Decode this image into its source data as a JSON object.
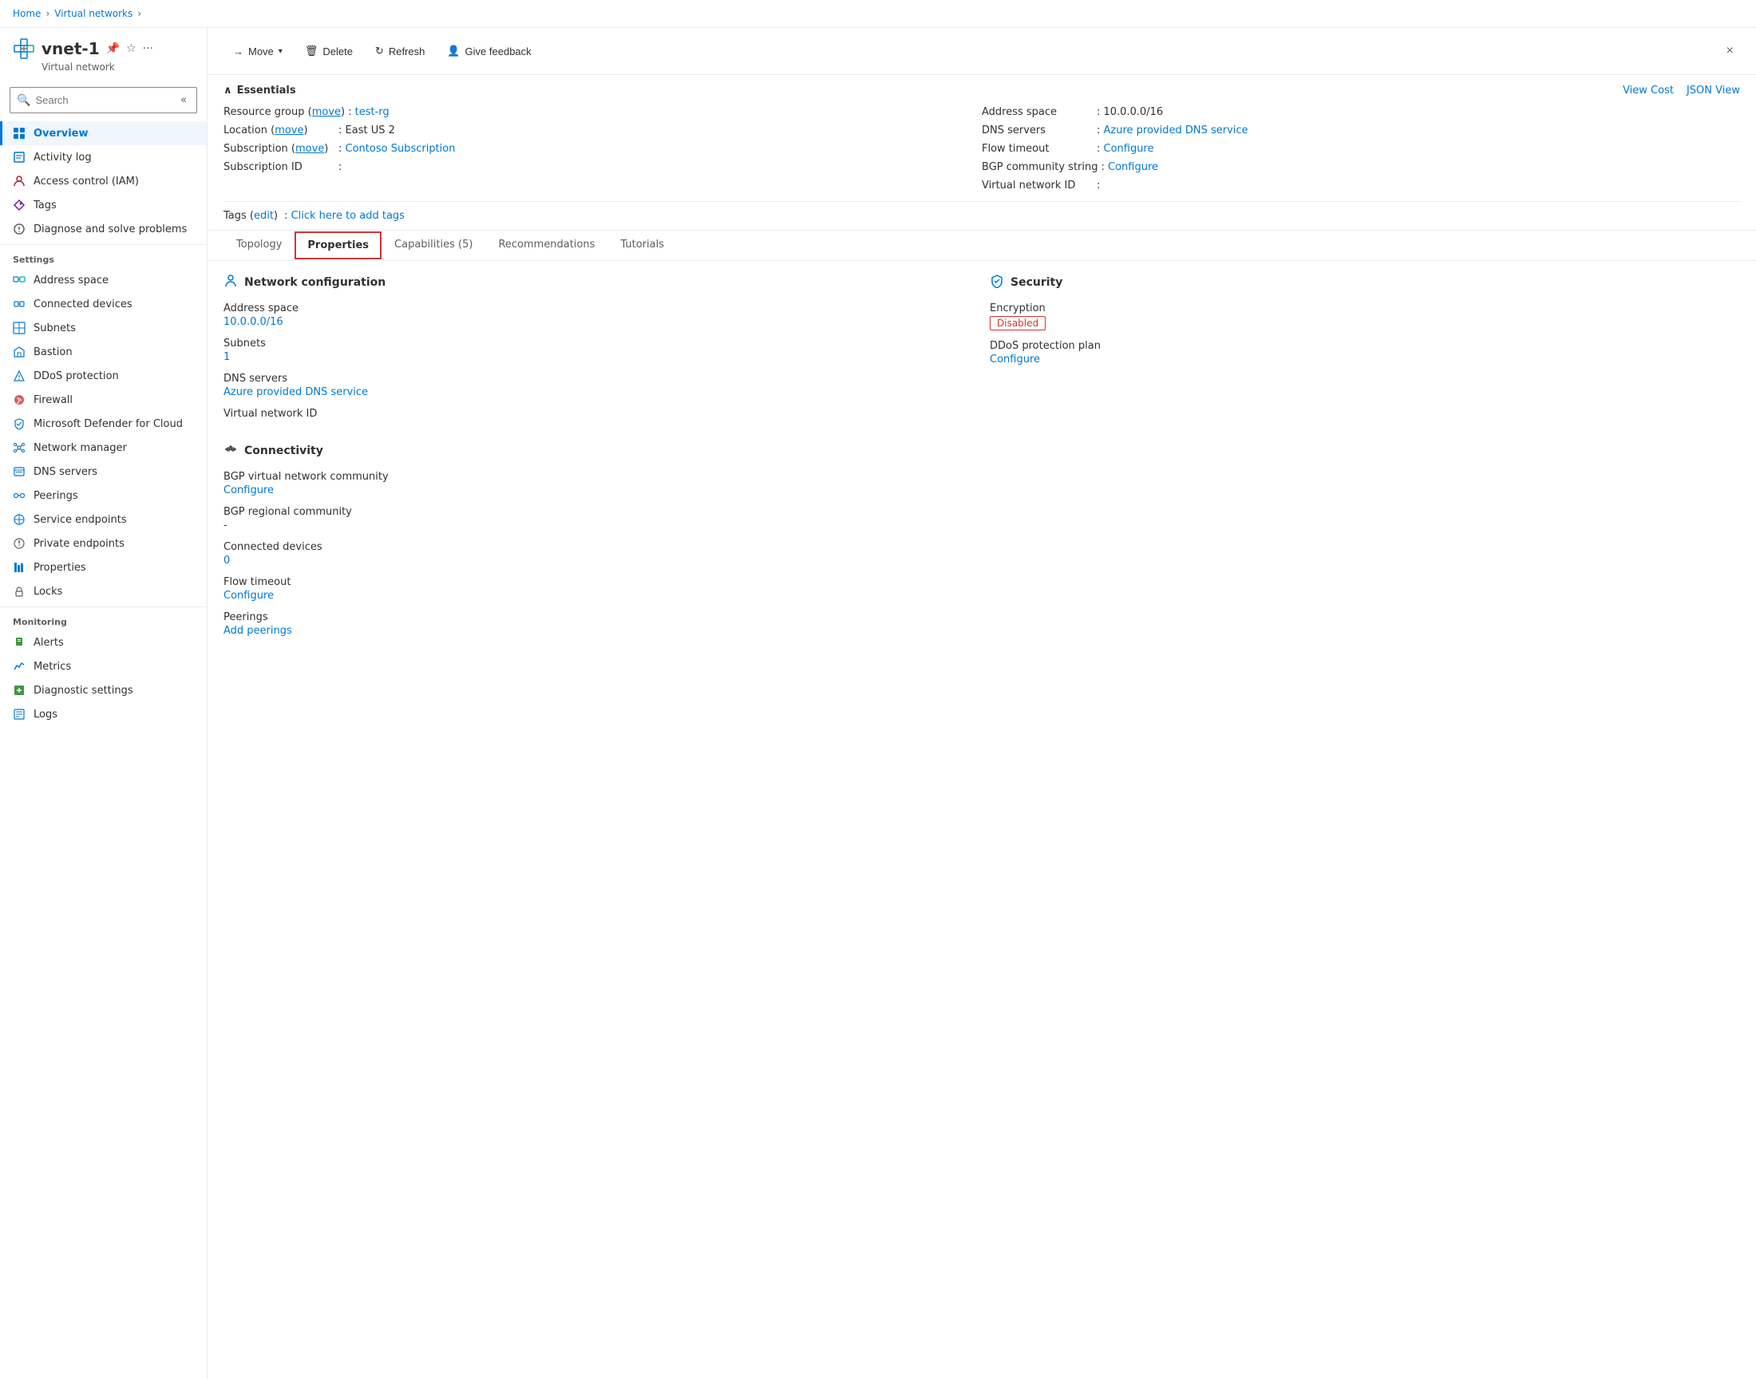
{
  "breadcrumb": {
    "items": [
      {
        "label": "Home",
        "link": true
      },
      {
        "label": "Virtual networks",
        "link": true
      },
      {
        "label": "",
        "link": false
      }
    ]
  },
  "resource": {
    "name": "vnet-1",
    "type": "Virtual network"
  },
  "toolbar": {
    "move_label": "Move",
    "delete_label": "Delete",
    "refresh_label": "Refresh",
    "feedback_label": "Give feedback",
    "close_label": "×"
  },
  "essentials": {
    "title": "Essentials",
    "view_cost_label": "View Cost",
    "json_view_label": "JSON View",
    "left_fields": [
      {
        "label": "Resource group (move)",
        "label_plain": "Resource group",
        "move_link": true,
        "value": "test-rg",
        "value_link": true
      },
      {
        "label": "Location (move)",
        "label_plain": "Location",
        "move_link": true,
        "value": "East US 2",
        "value_link": false
      },
      {
        "label": "Subscription (move)",
        "label_plain": "Subscription",
        "move_link": true,
        "value": "Contoso Subscription",
        "value_link": true
      },
      {
        "label": "Subscription ID",
        "label_plain": "Subscription ID",
        "move_link": false,
        "value": "",
        "value_link": false
      }
    ],
    "right_fields": [
      {
        "label": "Address space",
        "value": "10.0.0.0/16",
        "value_link": false
      },
      {
        "label": "DNS servers",
        "value": "Azure provided DNS service",
        "value_link": true
      },
      {
        "label": "Flow timeout",
        "value": "Configure",
        "value_link": true
      },
      {
        "label": "BGP community string",
        "value": "Configure",
        "value_link": true
      },
      {
        "label": "Virtual network ID",
        "value": "",
        "value_link": false
      }
    ]
  },
  "tags": {
    "label": "Tags (edit)",
    "value": "Click here to add tags"
  },
  "tabs": [
    {
      "label": "Topology",
      "active": false
    },
    {
      "label": "Properties",
      "active": true
    },
    {
      "label": "Capabilities (5)",
      "active": false
    },
    {
      "label": "Recommendations",
      "active": false
    },
    {
      "label": "Tutorials",
      "active": false
    }
  ],
  "network_config": {
    "section_title": "Network configuration",
    "fields": [
      {
        "label": "Address space",
        "value": "10.0.0.0/16",
        "value_link": true
      },
      {
        "label": "Subnets",
        "value": "1",
        "value_link": true
      },
      {
        "label": "DNS servers",
        "value": null
      },
      {
        "label": "DNS servers_value",
        "value": "Azure provided DNS service",
        "value_link": true
      },
      {
        "label": "Virtual network ID",
        "value": null
      }
    ]
  },
  "security": {
    "section_title": "Security",
    "fields": [
      {
        "label": "Encryption",
        "value": "Disabled",
        "is_badge": true
      },
      {
        "label": "DDoS protection plan",
        "value": "Configure",
        "value_link": true
      }
    ]
  },
  "connectivity": {
    "section_title": "Connectivity",
    "fields": [
      {
        "label": "BGP virtual network community",
        "value": null
      },
      {
        "label": "BGP virtual network community_link",
        "value": "Configure",
        "value_link": true
      },
      {
        "label": "BGP regional community",
        "value": "-",
        "value_link": false
      },
      {
        "label": "Connected devices",
        "value": null
      },
      {
        "label": "Connected devices_num",
        "value": "0",
        "value_link": true
      },
      {
        "label": "Flow timeout",
        "value": null
      },
      {
        "label": "Flow timeout_link",
        "value": "Configure",
        "value_link": true
      },
      {
        "label": "Peerings",
        "value": null
      },
      {
        "label": "Peerings_link",
        "value": "Add peerings",
        "value_link": true
      }
    ]
  },
  "sidebar": {
    "search_placeholder": "Search",
    "items": [
      {
        "label": "Overview",
        "active": true,
        "section": null,
        "icon": "overview"
      },
      {
        "label": "Activity log",
        "active": false,
        "section": null,
        "icon": "activity"
      },
      {
        "label": "Access control (IAM)",
        "active": false,
        "section": null,
        "icon": "iam"
      },
      {
        "label": "Tags",
        "active": false,
        "section": null,
        "icon": "tags"
      },
      {
        "label": "Diagnose and solve problems",
        "active": false,
        "section": null,
        "icon": "diagnose"
      },
      {
        "label": "Settings",
        "section": "Settings",
        "is_header": true
      },
      {
        "label": "Address space",
        "active": false,
        "section": "Settings",
        "icon": "address"
      },
      {
        "label": "Connected devices",
        "active": false,
        "section": "Settings",
        "icon": "connected"
      },
      {
        "label": "Subnets",
        "active": false,
        "section": "Settings",
        "icon": "subnets"
      },
      {
        "label": "Bastion",
        "active": false,
        "section": "Settings",
        "icon": "bastion"
      },
      {
        "label": "DDoS protection",
        "active": false,
        "section": "Settings",
        "icon": "ddos"
      },
      {
        "label": "Firewall",
        "active": false,
        "section": "Settings",
        "icon": "firewall"
      },
      {
        "label": "Microsoft Defender for Cloud",
        "active": false,
        "section": "Settings",
        "icon": "defender"
      },
      {
        "label": "Network manager",
        "active": false,
        "section": "Settings",
        "icon": "netmgr"
      },
      {
        "label": "DNS servers",
        "active": false,
        "section": "Settings",
        "icon": "dns"
      },
      {
        "label": "Peerings",
        "active": false,
        "section": "Settings",
        "icon": "peerings"
      },
      {
        "label": "Service endpoints",
        "active": false,
        "section": "Settings",
        "icon": "endpoints"
      },
      {
        "label": "Private endpoints",
        "active": false,
        "section": "Settings",
        "icon": "private"
      },
      {
        "label": "Properties",
        "active": false,
        "section": "Settings",
        "icon": "properties"
      },
      {
        "label": "Locks",
        "active": false,
        "section": "Settings",
        "icon": "locks"
      },
      {
        "label": "Monitoring",
        "section": "Monitoring",
        "is_header": true
      },
      {
        "label": "Alerts",
        "active": false,
        "section": "Monitoring",
        "icon": "alerts"
      },
      {
        "label": "Metrics",
        "active": false,
        "section": "Monitoring",
        "icon": "metrics"
      },
      {
        "label": "Diagnostic settings",
        "active": false,
        "section": "Monitoring",
        "icon": "diagnostic"
      },
      {
        "label": "Logs",
        "active": false,
        "section": "Monitoring",
        "icon": "logs"
      }
    ]
  }
}
